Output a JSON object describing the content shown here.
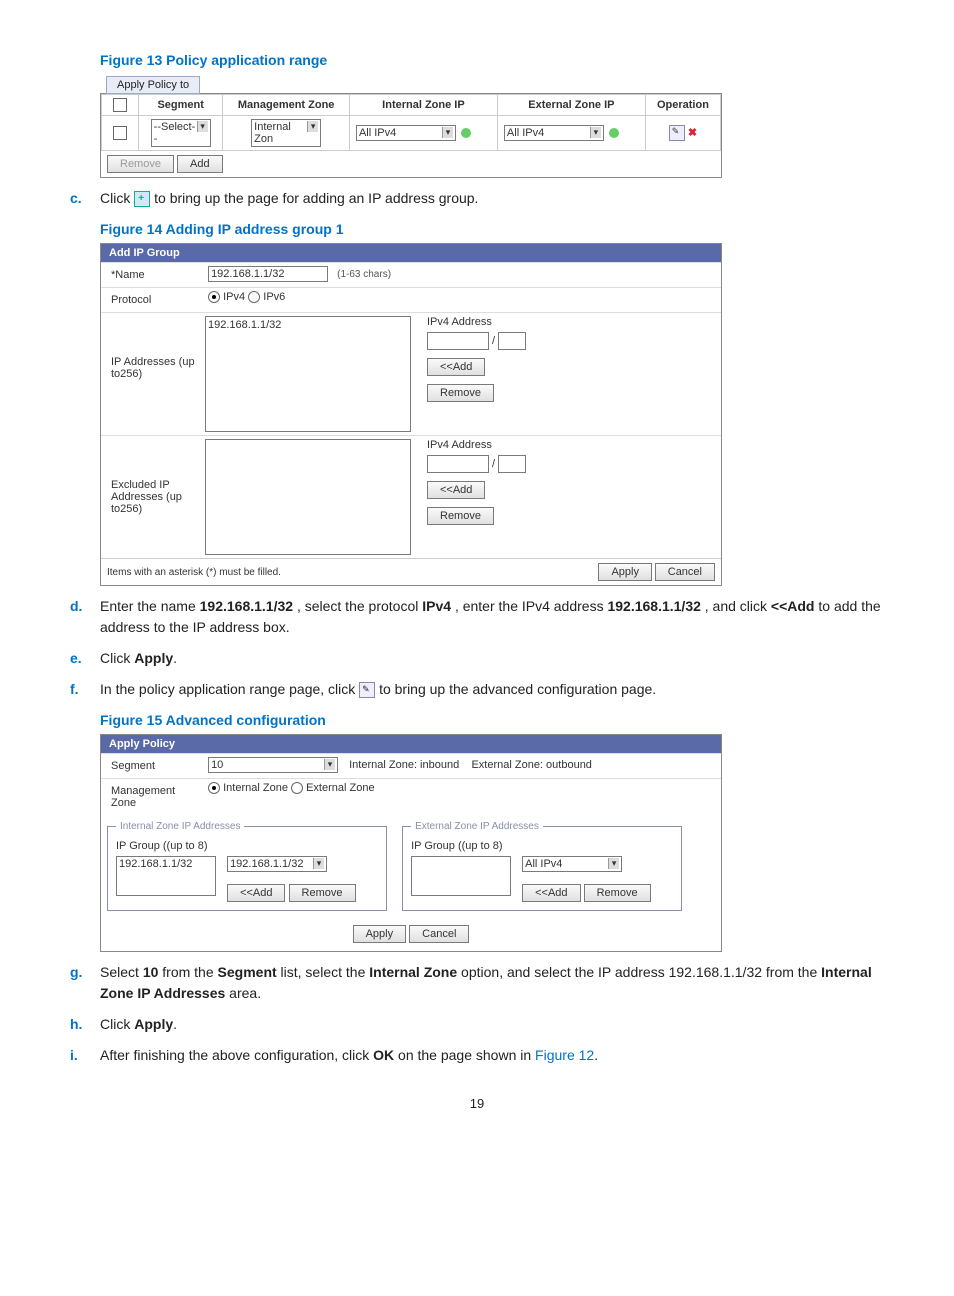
{
  "figures": {
    "f13": "Figure 13 Policy application range",
    "f14": "Figure 14 Adding IP address group 1",
    "f15": "Figure 15 Advanced configuration"
  },
  "steps": {
    "c": {
      "marker": "c.",
      "text_before": "Click ",
      "text_after": " to bring up the page for adding an IP address group."
    },
    "d": {
      "marker": "d.",
      "t1": "Enter the name ",
      "b1": "192.168.1.1/32",
      "t2": ", select the protocol ",
      "b2": "IPv4",
      "t3": ", enter the IPv4 address ",
      "b3": "192.168.1.1/32",
      "t4": ", and click ",
      "b4": "<<Add",
      "t5": " to add the address to the IP address box."
    },
    "e": {
      "marker": "e.",
      "t1": "Click ",
      "b1": "Apply",
      "t2": "."
    },
    "f": {
      "marker": "f.",
      "t1": "In the policy application range page, click ",
      "t2": " to bring up the advanced configuration page."
    },
    "g": {
      "marker": "g.",
      "t1": "Select ",
      "b1": "10",
      "t2": " from the ",
      "b2": "Segment",
      "t3": " list, select the ",
      "b3": "Internal Zone",
      "t4": " option, and select the IP address 192.168.1.1/32 from the ",
      "b4": "Internal Zone IP Addresses",
      "t5": " area."
    },
    "h": {
      "marker": "h.",
      "t1": "Click ",
      "b1": "Apply",
      "t2": "."
    },
    "i": {
      "marker": "i.",
      "t1": "After finishing the above configuration, click ",
      "b1": "OK",
      "t2": " on the page shown in ",
      "link": "Figure 12",
      "t3": "."
    }
  },
  "panel13": {
    "tab": "Apply Policy to",
    "th": [
      "",
      "Segment",
      "Management Zone",
      "Internal Zone IP",
      "External Zone IP",
      "Operation"
    ],
    "row": {
      "segment": "--Select--",
      "mgmt": "Internal Zon",
      "intip": "All IPv4",
      "extip": "All IPv4"
    },
    "buttons": {
      "remove": "Remove",
      "add": "Add"
    }
  },
  "panel14": {
    "title": "Add IP Group",
    "name_label": "*Name",
    "name_value": "192.168.1.1/32",
    "name_hint": "(1-63   chars)",
    "proto_label": "Protocol",
    "proto_ipv4": "IPv4",
    "proto_ipv6": "IPv6",
    "ipaddr_label": "IP Addresses (up to256)",
    "excl_label": "Excluded IP Addresses (up to256)",
    "list_value": "192.168.1.1/32",
    "side_label": "IPv4 Address",
    "add_btn": "<<Add",
    "remove_btn": "Remove",
    "footer_note": "Items with an asterisk (*) must be filled.",
    "apply": "Apply",
    "cancel": "Cancel"
  },
  "panel15": {
    "title": "Apply Policy",
    "segment_label": "Segment",
    "segment_value": "10",
    "zone_info1": "Internal Zone: inbound",
    "zone_info2": "External Zone: outbound",
    "mgmt_label": "Management Zone",
    "mz_int": "Internal Zone",
    "mz_ext": "External Zone",
    "int_legend": "Internal Zone IP Addresses",
    "ext_legend": "External Zone IP Addresses",
    "ipg_label": "IP Group ((up to 8)",
    "int_list_value": "192.168.1.1/32",
    "int_sel": "192.168.1.1/32",
    "ext_sel": "All IPv4",
    "add_btn": "<<Add",
    "remove_btn": "Remove",
    "apply": "Apply",
    "cancel": "Cancel"
  },
  "page_number": "19"
}
